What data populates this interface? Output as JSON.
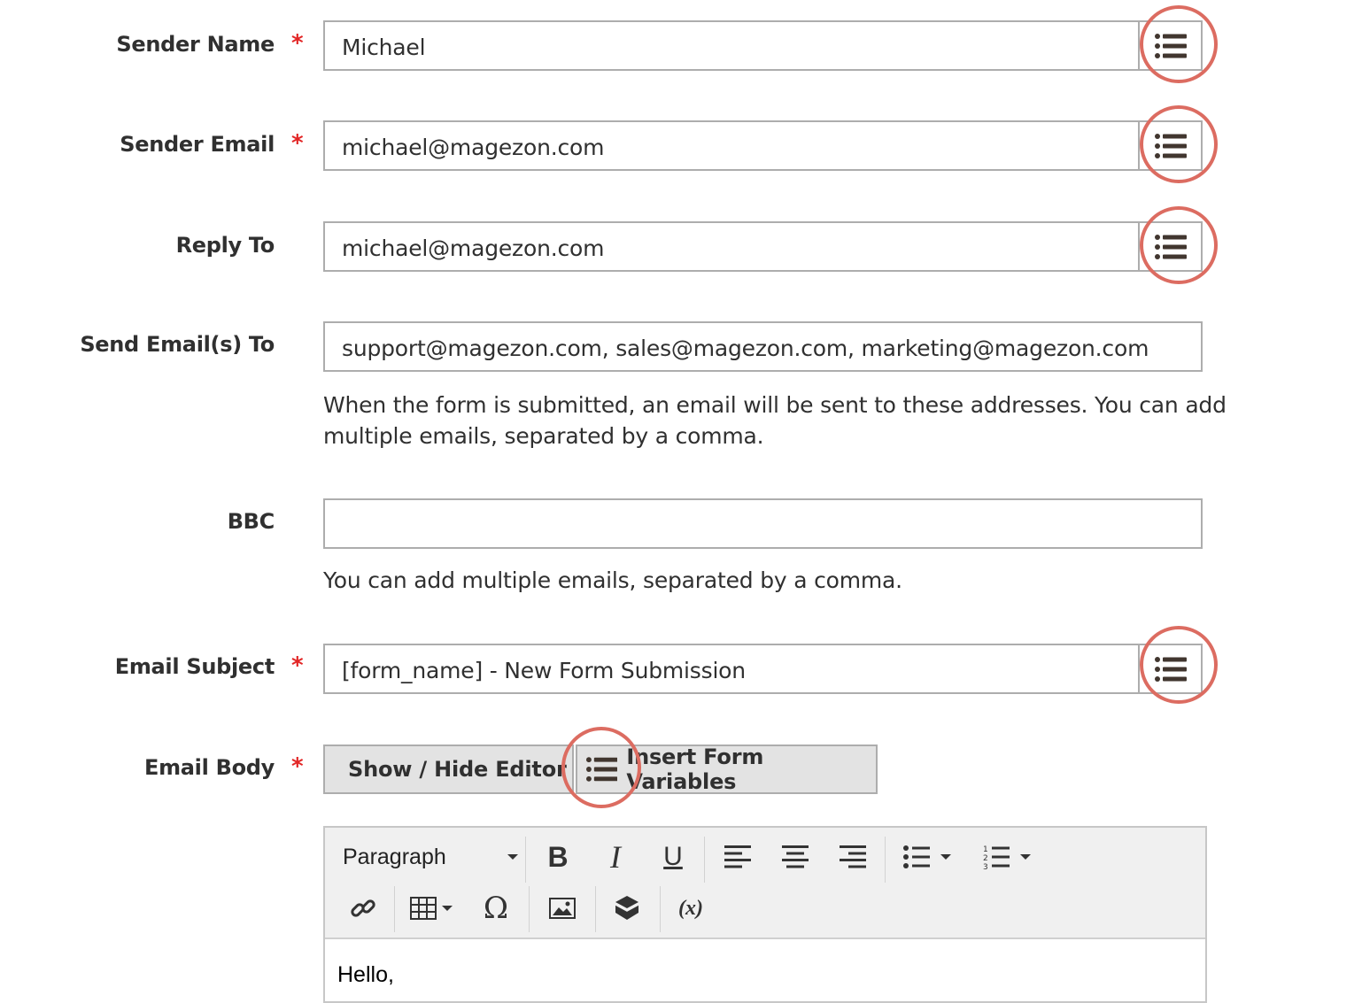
{
  "fields": {
    "sender_name": {
      "label": "Sender Name",
      "required": "*",
      "value": "Michael"
    },
    "sender_email": {
      "label": "Sender Email",
      "required": "*",
      "value": "michael@magezon.com"
    },
    "reply_to": {
      "label": "Reply To",
      "value": "michael@magezon.com"
    },
    "send_to": {
      "label": "Send Email(s) To",
      "value": "support@magezon.com, sales@magezon.com, marketing@magezon.com",
      "note_line1": "When the form is submitted, an email will be sent to these addresses. You can add",
      "note_line2": "multiple emails, separated by a comma."
    },
    "bbc": {
      "label": "BBC",
      "value": "",
      "note": "You can add multiple emails, separated by a comma."
    },
    "email_subject": {
      "label": "Email Subject",
      "required": "*",
      "value": "[form_name] - New Form Submission"
    },
    "email_body": {
      "label": "Email Body",
      "required": "*",
      "show_hide_label": "Show / Hide Editor",
      "insert_variables_label": "Insert Form Variables"
    }
  },
  "editor": {
    "format_select": "Paragraph",
    "variable_button": "(x)",
    "content": "Hello,"
  },
  "colors": {
    "required": "#e22626",
    "highlight_ring": "#dc6c61",
    "icon": "#41362f"
  },
  "icons": [
    "list-icon",
    "bold-icon",
    "italic-icon",
    "underline-icon",
    "align-left-icon",
    "align-center-icon",
    "align-right-icon",
    "bullet-list-icon",
    "numbered-list-icon",
    "link-icon",
    "table-icon",
    "omega-icon",
    "image-icon",
    "widget-icon",
    "variable-icon"
  ]
}
